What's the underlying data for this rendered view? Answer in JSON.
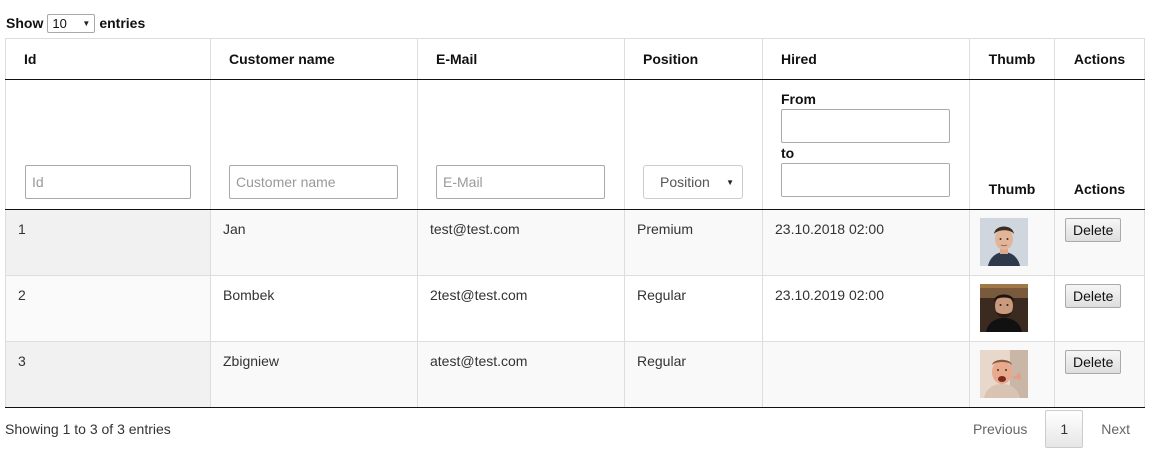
{
  "length": {
    "show_label": "Show",
    "value": "10",
    "entries_label": "entries"
  },
  "table": {
    "headers": [
      "Id",
      "Customer name",
      "E-Mail",
      "Position",
      "Hired",
      "Thumb",
      "Actions"
    ],
    "filters": {
      "id_placeholder": "Id",
      "name_placeholder": "Customer name",
      "email_placeholder": "E-Mail",
      "position_value": "Position",
      "hired_from_label": "From",
      "hired_to_label": "to",
      "thumb_label": "Thumb",
      "actions_label": "Actions"
    },
    "rows": [
      {
        "id": "1",
        "name": "Jan",
        "email": "test@test.com",
        "position": "Premium",
        "hired": "23.10.2018 02:00",
        "action": "Delete"
      },
      {
        "id": "2",
        "name": "Bombek",
        "email": "2test@test.com",
        "position": "Regular",
        "hired": "23.10.2019 02:00",
        "action": "Delete"
      },
      {
        "id": "3",
        "name": "Zbigniew",
        "email": "atest@test.com",
        "position": "Regular",
        "hired": "",
        "action": "Delete"
      }
    ]
  },
  "footer": {
    "info": "Showing 1 to 3 of 3 entries",
    "previous": "Previous",
    "page": "1",
    "next": "Next"
  }
}
